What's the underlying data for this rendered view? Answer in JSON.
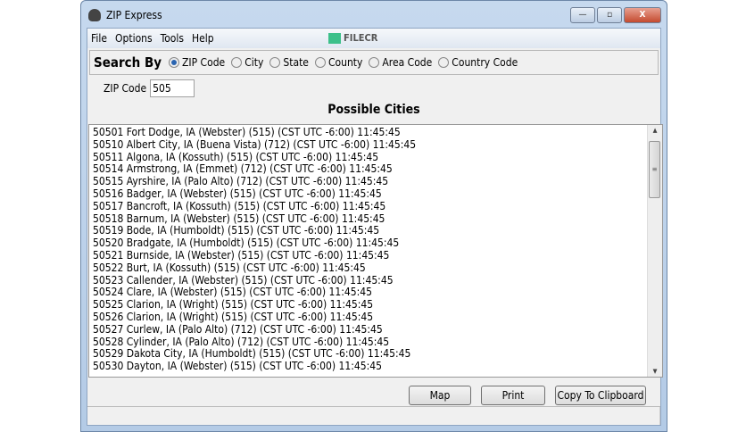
{
  "window": {
    "title": "ZIP Express",
    "minimize": "—",
    "maximize": "▫",
    "close": "X"
  },
  "menu": [
    "File",
    "Options",
    "Tools",
    "Help"
  ],
  "watermark": "FILECR",
  "search_by": {
    "label": "Search By",
    "options": [
      {
        "label": "ZIP Code",
        "selected": true
      },
      {
        "label": "City",
        "selected": false
      },
      {
        "label": "State",
        "selected": false
      },
      {
        "label": "County",
        "selected": false
      },
      {
        "label": "Area Code",
        "selected": false
      },
      {
        "label": "Country Code",
        "selected": false
      }
    ]
  },
  "zip": {
    "label": "ZIP Code",
    "value": "505"
  },
  "results": {
    "heading": "Possible Cities",
    "rows": [
      "50501 Fort Dodge, IA (Webster) (515) (CST  UTC -6:00) 11:45:45",
      "50510 Albert City, IA (Buena Vista) (712) (CST  UTC -6:00) 11:45:45",
      "50511 Algona, IA (Kossuth) (515) (CST  UTC -6:00) 11:45:45",
      "50514 Armstrong, IA (Emmet) (712) (CST  UTC -6:00) 11:45:45",
      "50515 Ayrshire, IA (Palo Alto) (712) (CST  UTC -6:00) 11:45:45",
      "50516 Badger, IA (Webster) (515) (CST  UTC -6:00) 11:45:45",
      "50517 Bancroft, IA (Kossuth) (515) (CST  UTC -6:00) 11:45:45",
      "50518 Barnum, IA (Webster) (515) (CST  UTC -6:00) 11:45:45",
      "50519 Bode, IA (Humboldt) (515) (CST  UTC -6:00) 11:45:45",
      "50520 Bradgate, IA (Humboldt) (515) (CST  UTC -6:00) 11:45:45",
      "50521 Burnside, IA (Webster) (515) (CST  UTC -6:00) 11:45:45",
      "50522 Burt, IA (Kossuth) (515) (CST  UTC -6:00) 11:45:45",
      "50523 Callender, IA (Webster) (515) (CST  UTC -6:00) 11:45:45",
      "50524 Clare, IA (Webster) (515) (CST  UTC -6:00) 11:45:45",
      "50525 Clarion, IA (Wright) (515) (CST  UTC -6:00) 11:45:45",
      "50526 Clarion, IA (Wright) (515) (CST  UTC -6:00) 11:45:45",
      "50527 Curlew, IA (Palo Alto) (712) (CST  UTC -6:00) 11:45:45",
      "50528 Cylinder, IA (Palo Alto) (712) (CST  UTC -6:00) 11:45:45",
      "50529 Dakota City, IA (Humboldt) (515) (CST  UTC -6:00) 11:45:45",
      "50530 Dayton, IA (Webster) (515) (CST  UTC -6:00) 11:45:45"
    ]
  },
  "buttons": {
    "map": "Map",
    "print": "Print",
    "copy": "Copy To Clipboard"
  }
}
